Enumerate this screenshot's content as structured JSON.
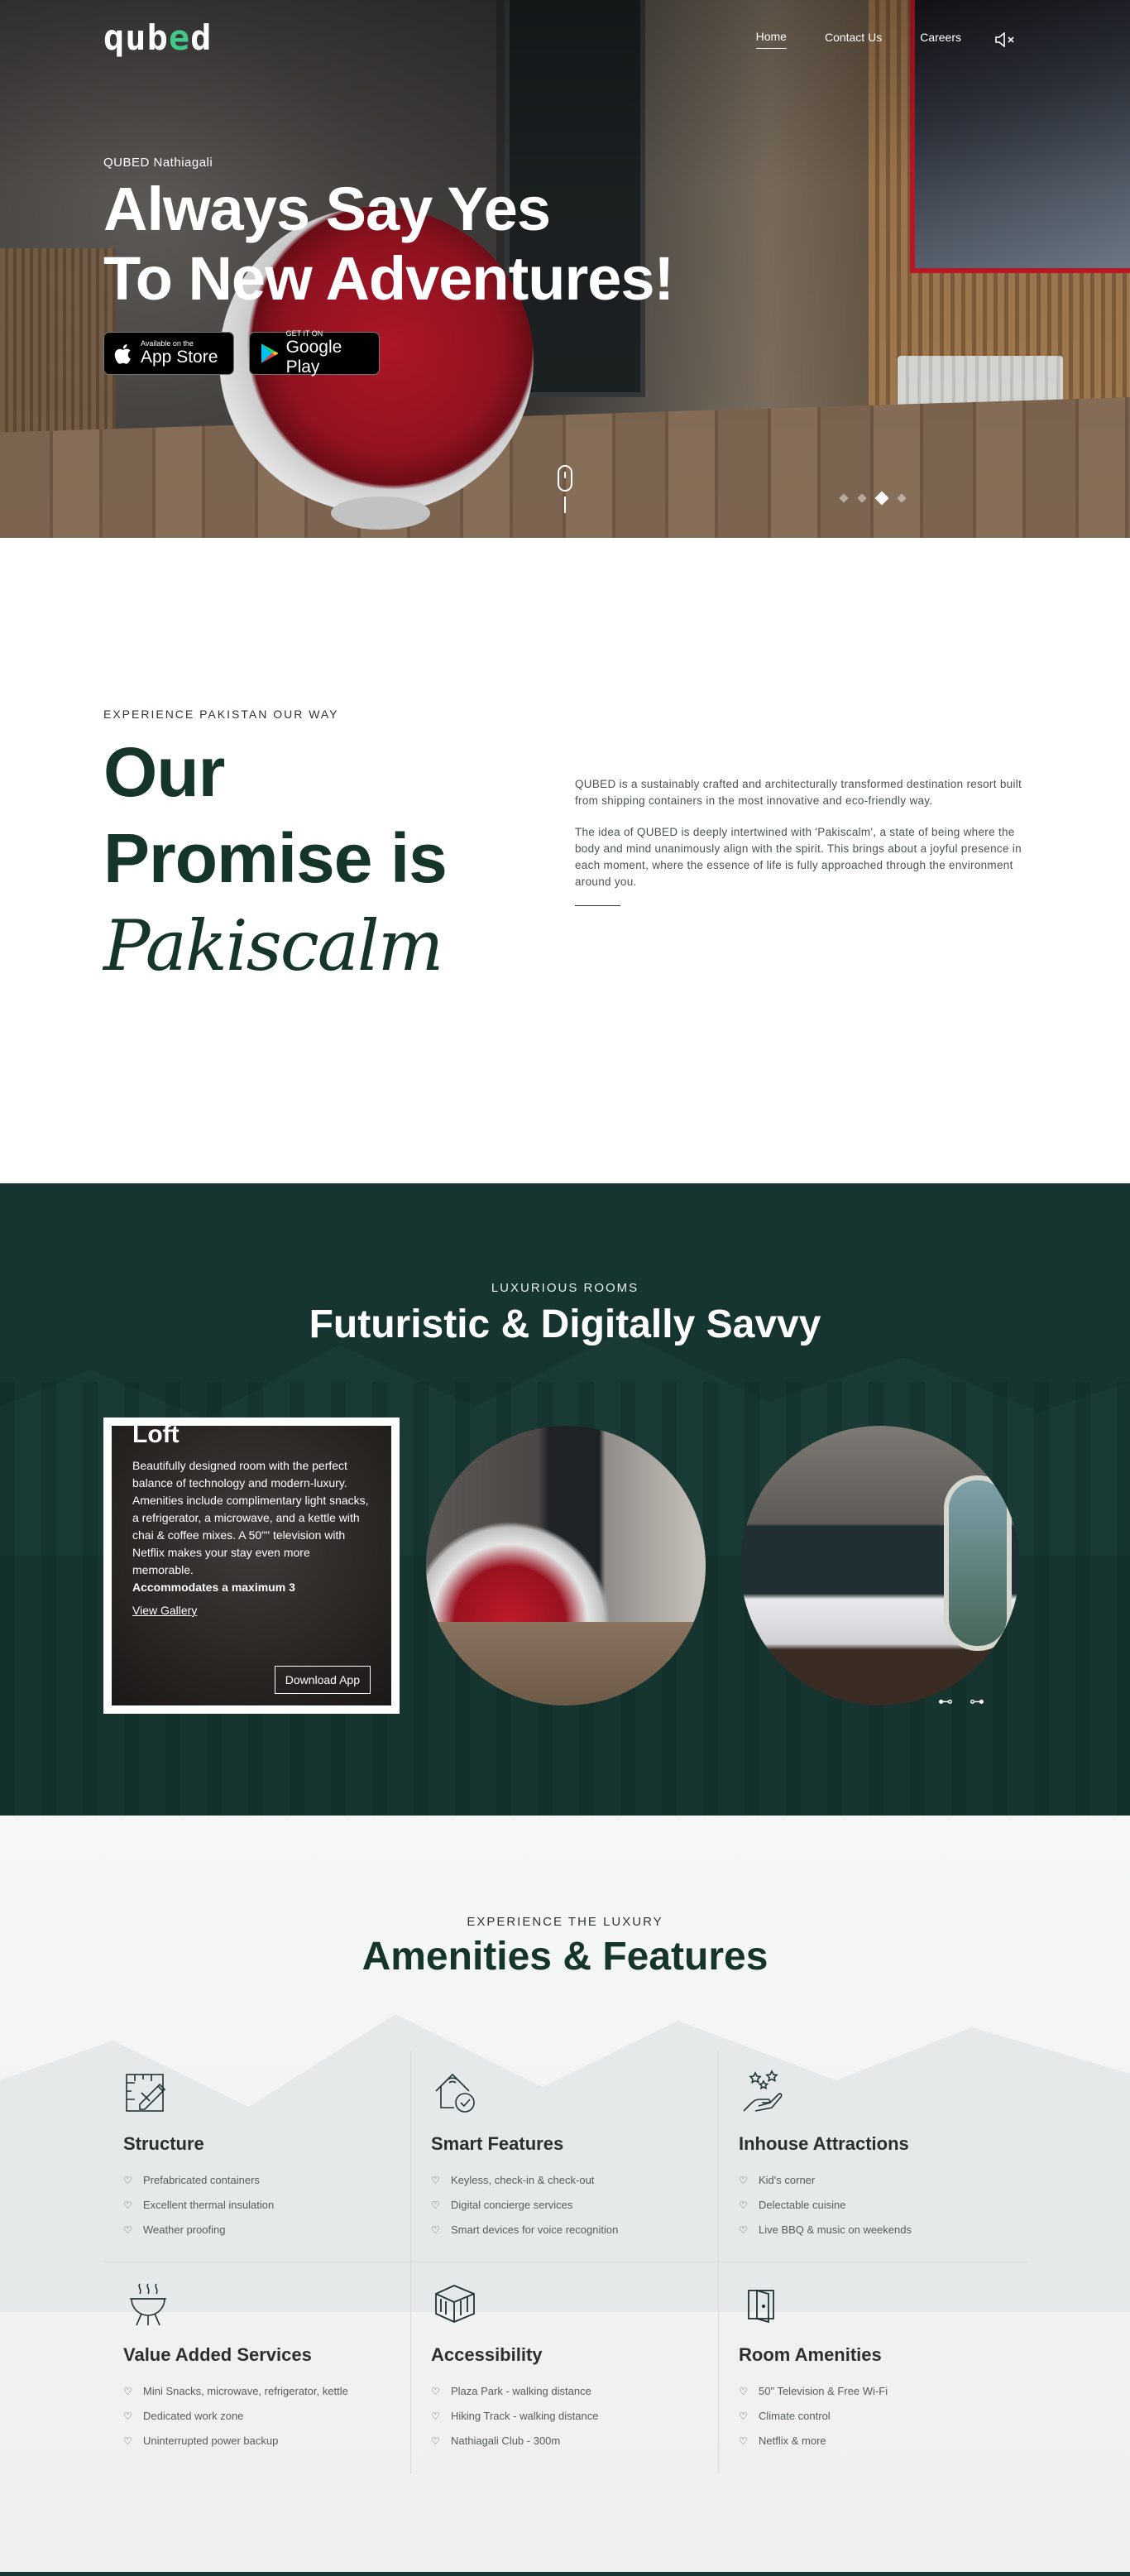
{
  "nav": {
    "logo": "qub",
    "logo_dot": "e",
    "logo_end": "d",
    "items": [
      {
        "label": "Home",
        "active": true
      },
      {
        "label": "Contact Us",
        "active": false
      },
      {
        "label": "Careers",
        "active": false
      }
    ],
    "mute_icon": "speaker-muted-icon"
  },
  "hero": {
    "kicker": "QUBED Nathiagali",
    "title_line1": "Always Say Yes",
    "title_line2": "To New Adventures!",
    "app_store_small": "Available on the",
    "app_store_big": "App Store",
    "google_small": "GET IT ON",
    "google_big": "Google Play"
  },
  "promise": {
    "eyebrow": "EXPERIENCE PAKISTAN OUR WAY",
    "line1": "Our",
    "line2": "Promise is",
    "script": "Pakiscalm",
    "para1": "QUBED is a sustainably crafted and architecturally transformed destination resort built from shipping containers in the most innovative and eco-friendly way.",
    "para2": "The idea of QUBED is deeply intertwined with 'Pakiscalm', a state of being where the body and mind unanimously align with the spirit. This brings about a joyful presence in each moment, where the essence of life is fully approached through the environment around you."
  },
  "rooms": {
    "eyebrow": "LUXURIOUS ROOMS",
    "title": "Futuristic & Digitally Savvy",
    "card": {
      "name": "Loft",
      "desc": "Beautifully designed room with the perfect balance of technology and modern-luxury. Amenities include complimentary light snacks, a refrigerator, a microwave, and a kettle with chai & coffee mixes. A 50\"\" television with Netflix makes your stay even more memorable.",
      "capacity": "Accommodates a maximum 3",
      "gallery": "View Gallery",
      "download": "Download App"
    },
    "prev": "⊷",
    "next": "⊶"
  },
  "amenities": {
    "eyebrow": "EXPERIENCE THE LUXURY",
    "title": "Amenities & Features",
    "cells": [
      {
        "icon": "blueprint-icon",
        "title": "Structure",
        "items": [
          "Prefabricated containers",
          "Excellent thermal insulation",
          "Weather proofing"
        ]
      },
      {
        "icon": "smart-home-icon",
        "title": "Smart Features",
        "items": [
          "Keyless, check-in & check-out",
          "Digital concierge services",
          "Smart devices for voice recognition"
        ]
      },
      {
        "icon": "stars-hand-icon",
        "title": "Inhouse Attractions",
        "items": [
          "Kid's corner",
          "Delectable cuisine",
          "Live BBQ & music on weekends"
        ]
      },
      {
        "icon": "grill-icon",
        "title": "Value Added Services",
        "items": [
          "Mini Snacks, microwave, refrigerator, kettle",
          "Dedicated work zone",
          "Uninterrupted power backup"
        ]
      },
      {
        "icon": "container-box-icon",
        "title": "Accessibility",
        "items": [
          "Plaza Park - walking distance",
          "Hiking Track - walking distance",
          "Nathiagali Club - 300m"
        ]
      },
      {
        "icon": "door-icon",
        "title": "Room Amenities",
        "items": [
          "50\" Television & Free Wi-Fi",
          "Climate control",
          "Netflix & more"
        ]
      }
    ]
  }
}
